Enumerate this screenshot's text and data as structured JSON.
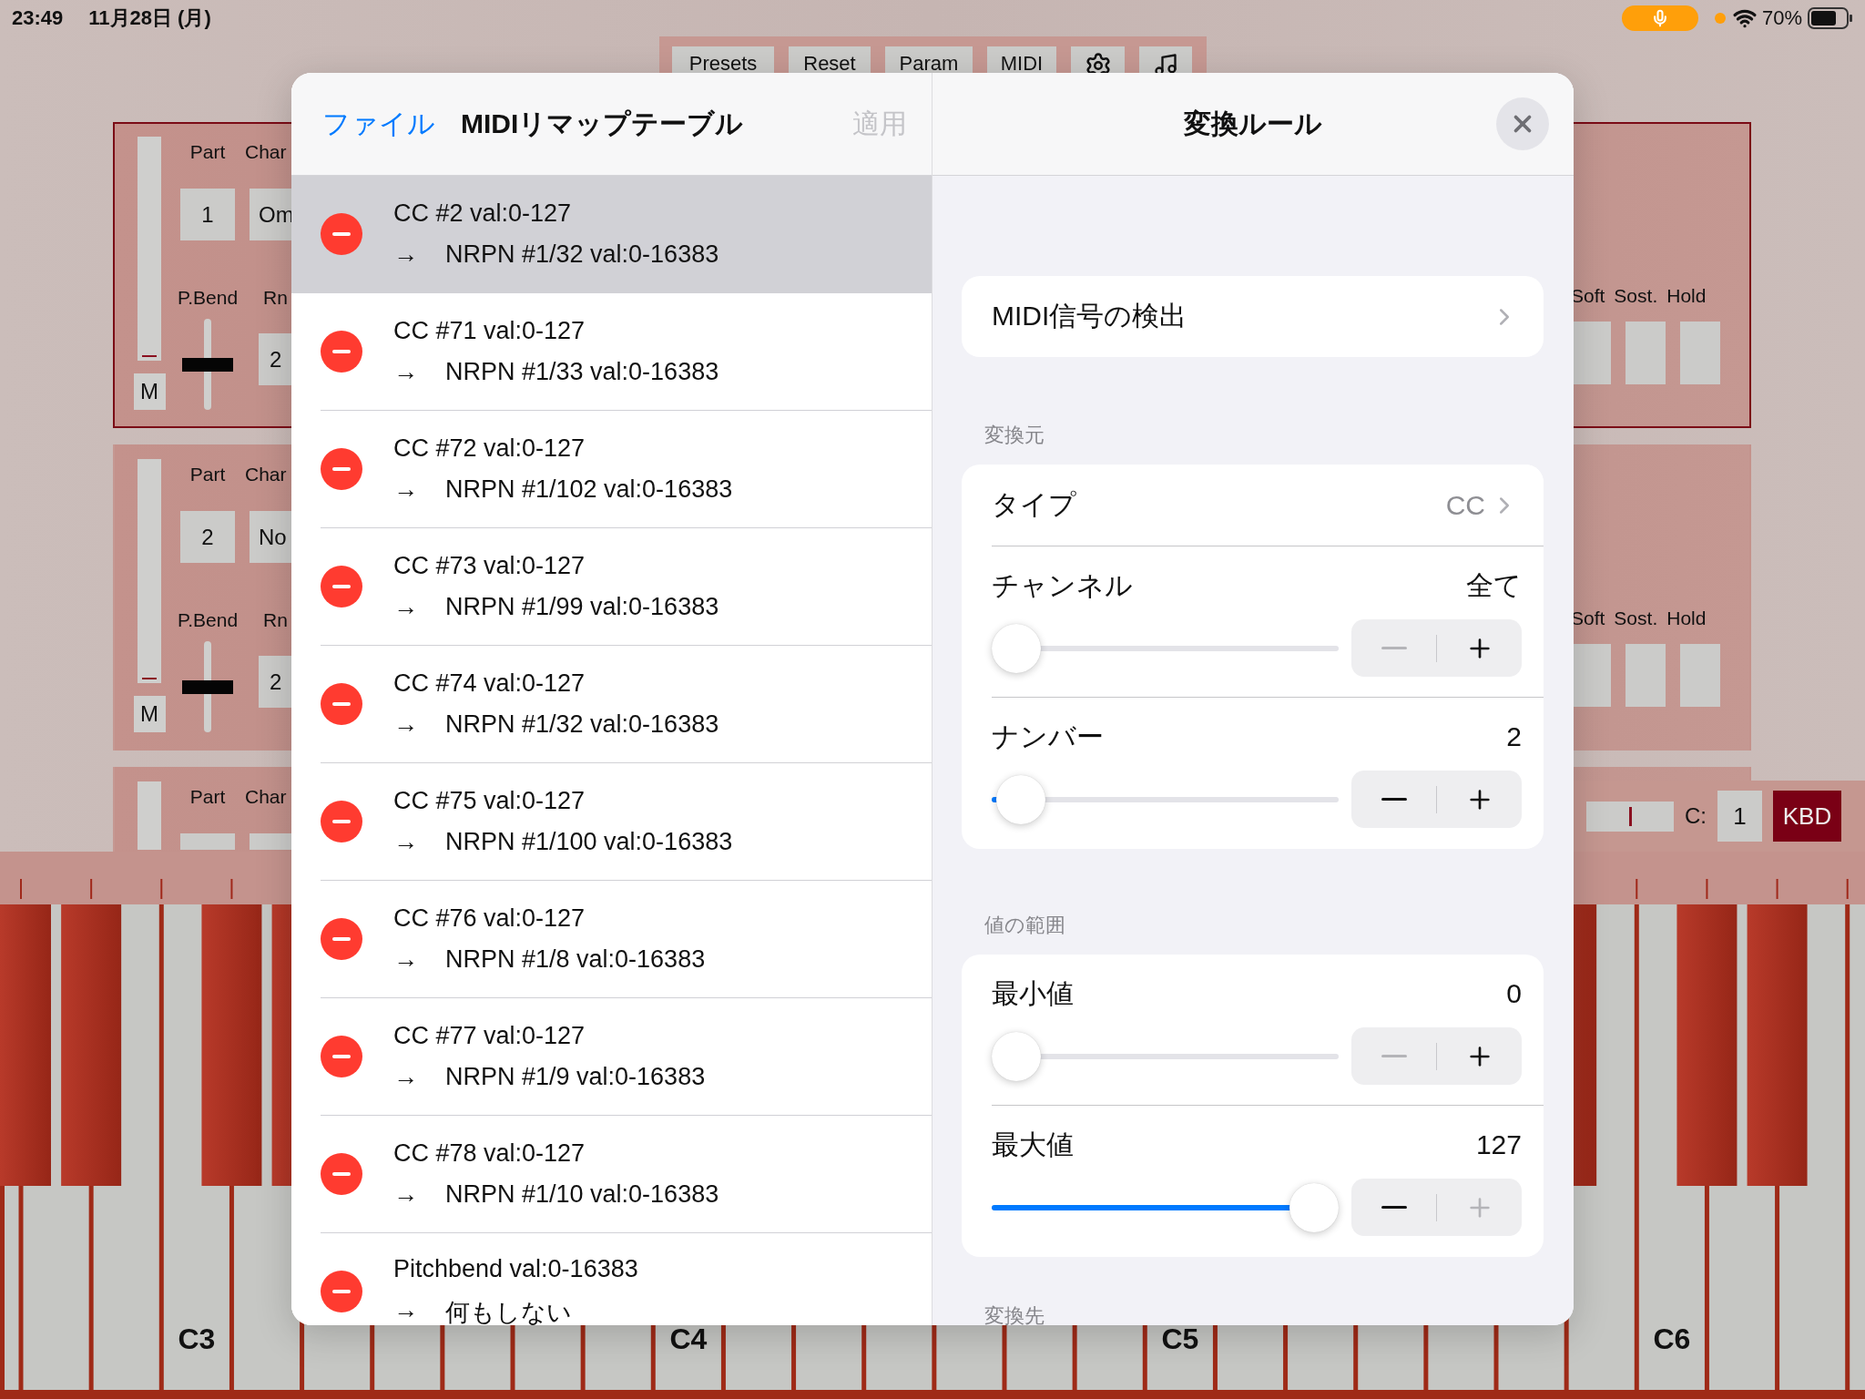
{
  "status_bar": {
    "time": "23:49",
    "date": "11月28日 (月)",
    "battery": "70%"
  },
  "toolbar": {
    "buttons": [
      {
        "kind": "text",
        "label": "Presets"
      },
      {
        "kind": "text",
        "label": "Reset"
      },
      {
        "kind": "text",
        "label": "Param"
      },
      {
        "kind": "text",
        "label": "MIDI"
      },
      {
        "kind": "gear"
      },
      {
        "kind": "note"
      }
    ]
  },
  "parts": [
    {
      "selected": true,
      "part_label": "Part",
      "channel_label": "Char",
      "part": "1",
      "channel": "Om",
      "fader": {
        "level": 0
      },
      "mute": "M",
      "bend_label": "P.Bend",
      "range_label": "Rn",
      "bend": {
        "level": 0.5
      },
      "range": "2",
      "pedals": [
        {
          "label": "Soft",
          "on": false
        },
        {
          "label": "Sost.",
          "on": false
        },
        {
          "label": "Hold",
          "on": false
        }
      ]
    },
    {
      "selected": false,
      "part_label": "Part",
      "channel_label": "Char",
      "part": "2",
      "channel": "No",
      "fader": {
        "level": 0
      },
      "mute": "M",
      "bend_label": "P.Bend",
      "range_label": "Rn",
      "bend": {
        "level": 0.5
      },
      "range": "2",
      "pedals": [
        {
          "label": "Soft",
          "on": false
        },
        {
          "label": "Sost.",
          "on": false
        },
        {
          "label": "Hold",
          "on": false
        }
      ]
    },
    {
      "selected": false,
      "part_label": "Part",
      "channel_label": "Char"
    }
  ],
  "remote_bar": {
    "slider": {
      "level": 0.5
    },
    "channel_label": "C:",
    "channel": "1",
    "mode_button": "KBD"
  },
  "keyboard": {
    "octave_labels": [
      "C3",
      "C4",
      "C5",
      "C6"
    ]
  },
  "dialog": {
    "left": {
      "back": "ファイル",
      "title": "MIDIリマップテーブル",
      "apply": "適用",
      "apply_disabled": true,
      "rules": [
        {
          "source": "CC #2 val:0-127",
          "arrow": "→",
          "target": "NRPN #1/32 val:0-16383",
          "selected": true
        },
        {
          "source": "CC #71 val:0-127",
          "arrow": "→",
          "target": "NRPN #1/33 val:0-16383",
          "selected": false
        },
        {
          "source": "CC #72 val:0-127",
          "arrow": "→",
          "target": "NRPN #1/102 val:0-16383",
          "selected": false
        },
        {
          "source": "CC #73 val:0-127",
          "arrow": "→",
          "target": "NRPN #1/99 val:0-16383",
          "selected": false
        },
        {
          "source": "CC #74 val:0-127",
          "arrow": "→",
          "target": "NRPN #1/32 val:0-16383",
          "selected": false
        },
        {
          "source": "CC #75 val:0-127",
          "arrow": "→",
          "target": "NRPN #1/100 val:0-16383",
          "selected": false
        },
        {
          "source": "CC #76 val:0-127",
          "arrow": "→",
          "target": "NRPN #1/8 val:0-16383",
          "selected": false
        },
        {
          "source": "CC #77 val:0-127",
          "arrow": "→",
          "target": "NRPN #1/9 val:0-16383",
          "selected": false
        },
        {
          "source": "CC #78 val:0-127",
          "arrow": "→",
          "target": "NRPN #1/10 val:0-16383",
          "selected": false
        },
        {
          "source": "Pitchbend val:0-16383",
          "arrow": "→",
          "target": "何もしない",
          "selected": false
        }
      ]
    },
    "right": {
      "title": "変換ルール",
      "detect": "MIDI信号の検出",
      "sections": [
        {
          "label": "変換元",
          "rows": [
            {
              "kind": "picker",
              "label": "タイプ",
              "value": "CC"
            },
            {
              "kind": "slider",
              "label": "チャンネル",
              "value": "全て",
              "level": 0,
              "minus_enabled": false,
              "plus_enabled": true
            },
            {
              "kind": "slider",
              "label": "ナンバー",
              "value": "2",
              "level": 0.016,
              "minus_enabled": true,
              "plus_enabled": true
            }
          ]
        },
        {
          "label": "値の範囲",
          "rows": [
            {
              "kind": "slider",
              "label": "最小値",
              "value": "0",
              "level": 0,
              "minus_enabled": false,
              "plus_enabled": true
            },
            {
              "kind": "slider",
              "label": "最大値",
              "value": "127",
              "level": 1,
              "minus_enabled": true,
              "plus_enabled": false
            }
          ]
        },
        {
          "label": "変換先"
        }
      ]
    }
  }
}
